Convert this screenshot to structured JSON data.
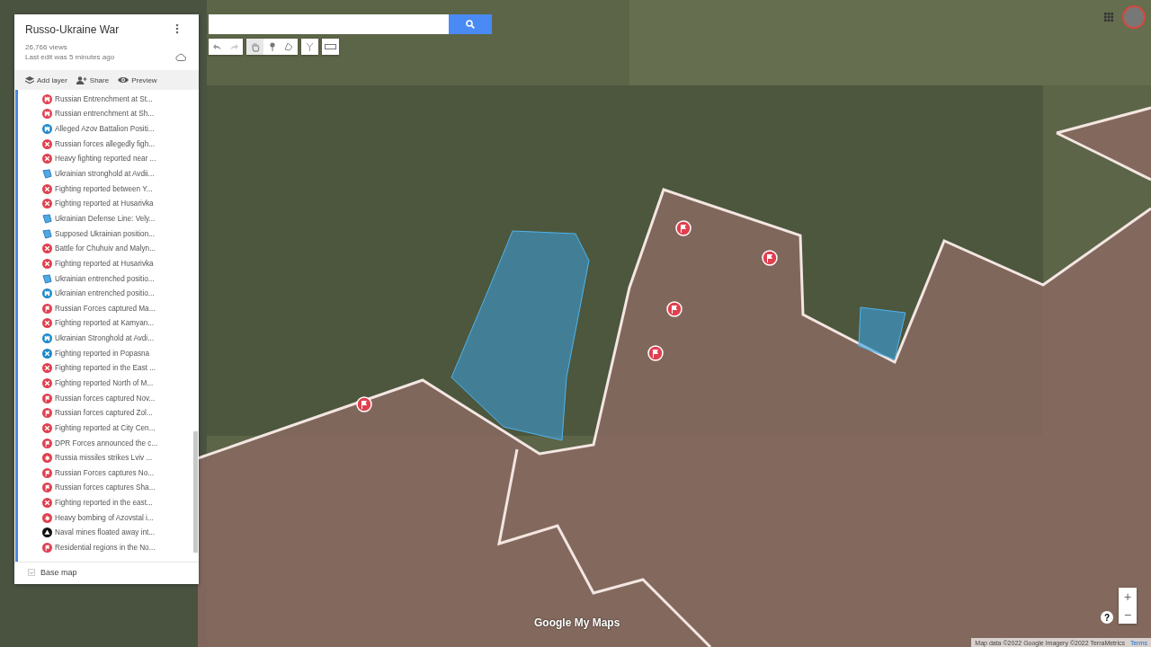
{
  "map_title": "Russo-Ukraine War",
  "views": "26,766 views",
  "last_edit": "Last edit was 5 minutes ago",
  "actions": [
    {
      "kind": "layers",
      "label": "Add layer"
    },
    {
      "kind": "share",
      "label": "Share"
    },
    {
      "kind": "preview",
      "label": "Preview"
    }
  ],
  "layer_items": [
    {
      "label": "Russian Entrenchment at St...",
      "kind": "castle",
      "color": "#e0404f"
    },
    {
      "label": "Russian entrenchment at Sh...",
      "kind": "castle",
      "color": "#e0404f"
    },
    {
      "label": "Alleged Azov Battalion Positi...",
      "kind": "castle",
      "color": "#1e88c8"
    },
    {
      "label": "Russian forces allegedly figh...",
      "kind": "cross",
      "color": "#e0404f"
    },
    {
      "label": "Heavy fighting reported near ...",
      "kind": "cross",
      "color": "#e0404f"
    },
    {
      "label": "Ukrainian stronghold at Avdii...",
      "kind": "polygon",
      "color": "#4fa8e0"
    },
    {
      "label": "Fighting reported between Y...",
      "kind": "cross",
      "color": "#e0404f"
    },
    {
      "label": "Fighting reported at Husarivka",
      "kind": "cross",
      "color": "#e0404f"
    },
    {
      "label": "Ukrainian Defense Line: Vely...",
      "kind": "polygon",
      "color": "#4fa8e0"
    },
    {
      "label": "Supposed Ukrainian position...",
      "kind": "polygon",
      "color": "#4fa8e0"
    },
    {
      "label": "Battle for Chuhuiv and Malyn...",
      "kind": "cross",
      "color": "#e0404f"
    },
    {
      "label": "Fighting reported at Husarivka",
      "kind": "cross",
      "color": "#e0404f"
    },
    {
      "label": "Ukrainian entrenched positio...",
      "kind": "polygon",
      "color": "#4fa8e0"
    },
    {
      "label": "Ukrainian entrenched positio...",
      "kind": "castle",
      "color": "#1e88c8"
    },
    {
      "label": "Russian Forces captured Ma...",
      "kind": "flag",
      "color": "#e0404f"
    },
    {
      "label": "Fighting reported at Kamyan...",
      "kind": "cross",
      "color": "#e0404f"
    },
    {
      "label": "Ukrainian Stronghold at Avdi...",
      "kind": "castle",
      "color": "#1e88c8"
    },
    {
      "label": "Fighting reported in Popasna",
      "kind": "cross",
      "color": "#1e88c8"
    },
    {
      "label": "Fighting reported in the East ...",
      "kind": "cross",
      "color": "#e0404f"
    },
    {
      "label": "Fighting reported North of M...",
      "kind": "cross",
      "color": "#e0404f"
    },
    {
      "label": "Russian forces captured Nov...",
      "kind": "flag",
      "color": "#e0404f"
    },
    {
      "label": "Russian forces captured Zol...",
      "kind": "flag",
      "color": "#e0404f"
    },
    {
      "label": "Fighting reported at City Cen...",
      "kind": "cross",
      "color": "#e0404f"
    },
    {
      "label": "DPR Forces announced the c...",
      "kind": "flag",
      "color": "#e0404f"
    },
    {
      "label": "Russia missiles strikes Lviv ...",
      "kind": "burst",
      "color": "#e0404f"
    },
    {
      "label": "Russian Forces captures No...",
      "kind": "flag",
      "color": "#e0404f"
    },
    {
      "label": "Russian forces captures Sha...",
      "kind": "flag",
      "color": "#e0404f"
    },
    {
      "label": "Fighting reported in the east...",
      "kind": "cross",
      "color": "#e0404f"
    },
    {
      "label": "Heavy bombing of Azovstal i...",
      "kind": "burst",
      "color": "#e0404f"
    },
    {
      "label": "Naval mines floated away int...",
      "kind": "warning",
      "color": "#111111"
    },
    {
      "label": "Residential regions in the No...",
      "kind": "flag",
      "color": "#e0404f"
    }
  ],
  "base_map": "Base map",
  "zoom_controls": [
    "+",
    "−"
  ],
  "help": "?",
  "logo": "Google My Maps",
  "attribution": "Map data ©2022 Google Imagery ©2022 TerraMetrics",
  "terms": "Terms"
}
